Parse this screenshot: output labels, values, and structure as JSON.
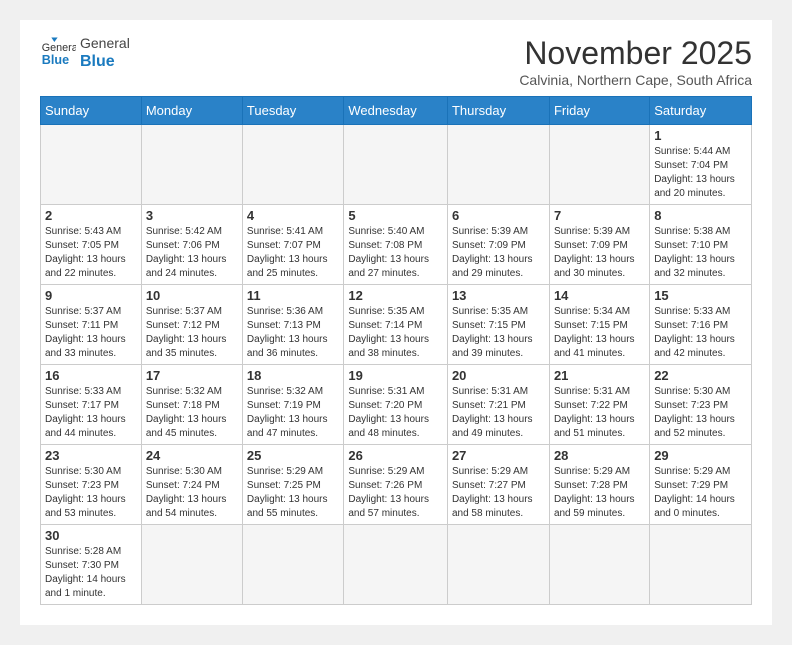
{
  "logo": {
    "general": "General",
    "blue": "Blue"
  },
  "title": {
    "month_year": "November 2025",
    "location": "Calvinia, Northern Cape, South Africa"
  },
  "days_of_week": [
    "Sunday",
    "Monday",
    "Tuesday",
    "Wednesday",
    "Thursday",
    "Friday",
    "Saturday"
  ],
  "weeks": [
    [
      {
        "day": "",
        "info": ""
      },
      {
        "day": "",
        "info": ""
      },
      {
        "day": "",
        "info": ""
      },
      {
        "day": "",
        "info": ""
      },
      {
        "day": "",
        "info": ""
      },
      {
        "day": "",
        "info": ""
      },
      {
        "day": "1",
        "info": "Sunrise: 5:44 AM\nSunset: 7:04 PM\nDaylight: 13 hours and 20 minutes."
      }
    ],
    [
      {
        "day": "2",
        "info": "Sunrise: 5:43 AM\nSunset: 7:05 PM\nDaylight: 13 hours and 22 minutes."
      },
      {
        "day": "3",
        "info": "Sunrise: 5:42 AM\nSunset: 7:06 PM\nDaylight: 13 hours and 24 minutes."
      },
      {
        "day": "4",
        "info": "Sunrise: 5:41 AM\nSunset: 7:07 PM\nDaylight: 13 hours and 25 minutes."
      },
      {
        "day": "5",
        "info": "Sunrise: 5:40 AM\nSunset: 7:08 PM\nDaylight: 13 hours and 27 minutes."
      },
      {
        "day": "6",
        "info": "Sunrise: 5:39 AM\nSunset: 7:09 PM\nDaylight: 13 hours and 29 minutes."
      },
      {
        "day": "7",
        "info": "Sunrise: 5:39 AM\nSunset: 7:09 PM\nDaylight: 13 hours and 30 minutes."
      },
      {
        "day": "8",
        "info": "Sunrise: 5:38 AM\nSunset: 7:10 PM\nDaylight: 13 hours and 32 minutes."
      }
    ],
    [
      {
        "day": "9",
        "info": "Sunrise: 5:37 AM\nSunset: 7:11 PM\nDaylight: 13 hours and 33 minutes."
      },
      {
        "day": "10",
        "info": "Sunrise: 5:37 AM\nSunset: 7:12 PM\nDaylight: 13 hours and 35 minutes."
      },
      {
        "day": "11",
        "info": "Sunrise: 5:36 AM\nSunset: 7:13 PM\nDaylight: 13 hours and 36 minutes."
      },
      {
        "day": "12",
        "info": "Sunrise: 5:35 AM\nSunset: 7:14 PM\nDaylight: 13 hours and 38 minutes."
      },
      {
        "day": "13",
        "info": "Sunrise: 5:35 AM\nSunset: 7:15 PM\nDaylight: 13 hours and 39 minutes."
      },
      {
        "day": "14",
        "info": "Sunrise: 5:34 AM\nSunset: 7:15 PM\nDaylight: 13 hours and 41 minutes."
      },
      {
        "day": "15",
        "info": "Sunrise: 5:33 AM\nSunset: 7:16 PM\nDaylight: 13 hours and 42 minutes."
      }
    ],
    [
      {
        "day": "16",
        "info": "Sunrise: 5:33 AM\nSunset: 7:17 PM\nDaylight: 13 hours and 44 minutes."
      },
      {
        "day": "17",
        "info": "Sunrise: 5:32 AM\nSunset: 7:18 PM\nDaylight: 13 hours and 45 minutes."
      },
      {
        "day": "18",
        "info": "Sunrise: 5:32 AM\nSunset: 7:19 PM\nDaylight: 13 hours and 47 minutes."
      },
      {
        "day": "19",
        "info": "Sunrise: 5:31 AM\nSunset: 7:20 PM\nDaylight: 13 hours and 48 minutes."
      },
      {
        "day": "20",
        "info": "Sunrise: 5:31 AM\nSunset: 7:21 PM\nDaylight: 13 hours and 49 minutes."
      },
      {
        "day": "21",
        "info": "Sunrise: 5:31 AM\nSunset: 7:22 PM\nDaylight: 13 hours and 51 minutes."
      },
      {
        "day": "22",
        "info": "Sunrise: 5:30 AM\nSunset: 7:23 PM\nDaylight: 13 hours and 52 minutes."
      }
    ],
    [
      {
        "day": "23",
        "info": "Sunrise: 5:30 AM\nSunset: 7:23 PM\nDaylight: 13 hours and 53 minutes."
      },
      {
        "day": "24",
        "info": "Sunrise: 5:30 AM\nSunset: 7:24 PM\nDaylight: 13 hours and 54 minutes."
      },
      {
        "day": "25",
        "info": "Sunrise: 5:29 AM\nSunset: 7:25 PM\nDaylight: 13 hours and 55 minutes."
      },
      {
        "day": "26",
        "info": "Sunrise: 5:29 AM\nSunset: 7:26 PM\nDaylight: 13 hours and 57 minutes."
      },
      {
        "day": "27",
        "info": "Sunrise: 5:29 AM\nSunset: 7:27 PM\nDaylight: 13 hours and 58 minutes."
      },
      {
        "day": "28",
        "info": "Sunrise: 5:29 AM\nSunset: 7:28 PM\nDaylight: 13 hours and 59 minutes."
      },
      {
        "day": "29",
        "info": "Sunrise: 5:29 AM\nSunset: 7:29 PM\nDaylight: 14 hours and 0 minutes."
      }
    ],
    [
      {
        "day": "30",
        "info": "Sunrise: 5:28 AM\nSunset: 7:30 PM\nDaylight: 14 hours and 1 minute."
      },
      {
        "day": "",
        "info": ""
      },
      {
        "day": "",
        "info": ""
      },
      {
        "day": "",
        "info": ""
      },
      {
        "day": "",
        "info": ""
      },
      {
        "day": "",
        "info": ""
      },
      {
        "day": "",
        "info": ""
      }
    ]
  ]
}
